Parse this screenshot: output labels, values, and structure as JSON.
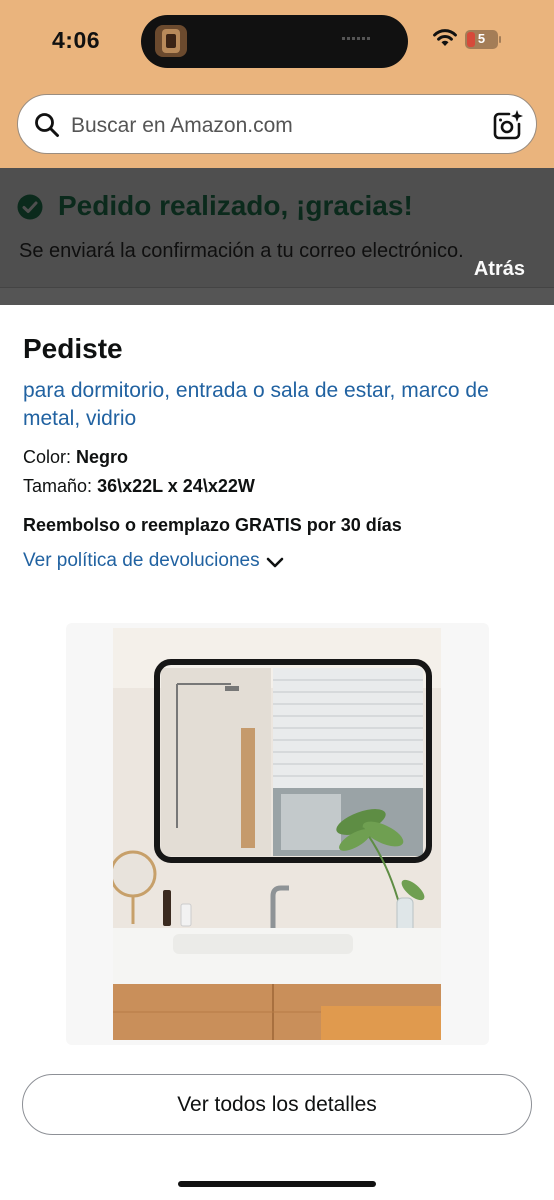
{
  "status_bar": {
    "time": "4:06",
    "battery": "5"
  },
  "search": {
    "placeholder": "Buscar en Amazon.com",
    "icon": "search-icon",
    "camera_icon": "camera-sparkle-icon"
  },
  "banner": {
    "title": "Pedido realizado, ¡gracias!",
    "message": "Se enviará la confirmación a tu correo electrónico.",
    "back_label": "Atrás"
  },
  "order": {
    "heading": "Pediste",
    "product_title": "para dormitorio, entrada o sala de estar, marco de metal, vidrio",
    "color_label": "Color:",
    "color_value": "Negro",
    "size_label": "Tamaño:",
    "size_value": "36\\x22L x 24\\x22W",
    "refund_text": "Reembolso o reemplazo GRATIS por 30 días",
    "policy_link": "Ver política de devoluciones",
    "details_button": "Ver todos los detalles"
  },
  "colors": {
    "header_bg": "#eab47d",
    "link": "#2162a1",
    "success": "#0b2a1c",
    "overlay": "#4f4f4f"
  }
}
